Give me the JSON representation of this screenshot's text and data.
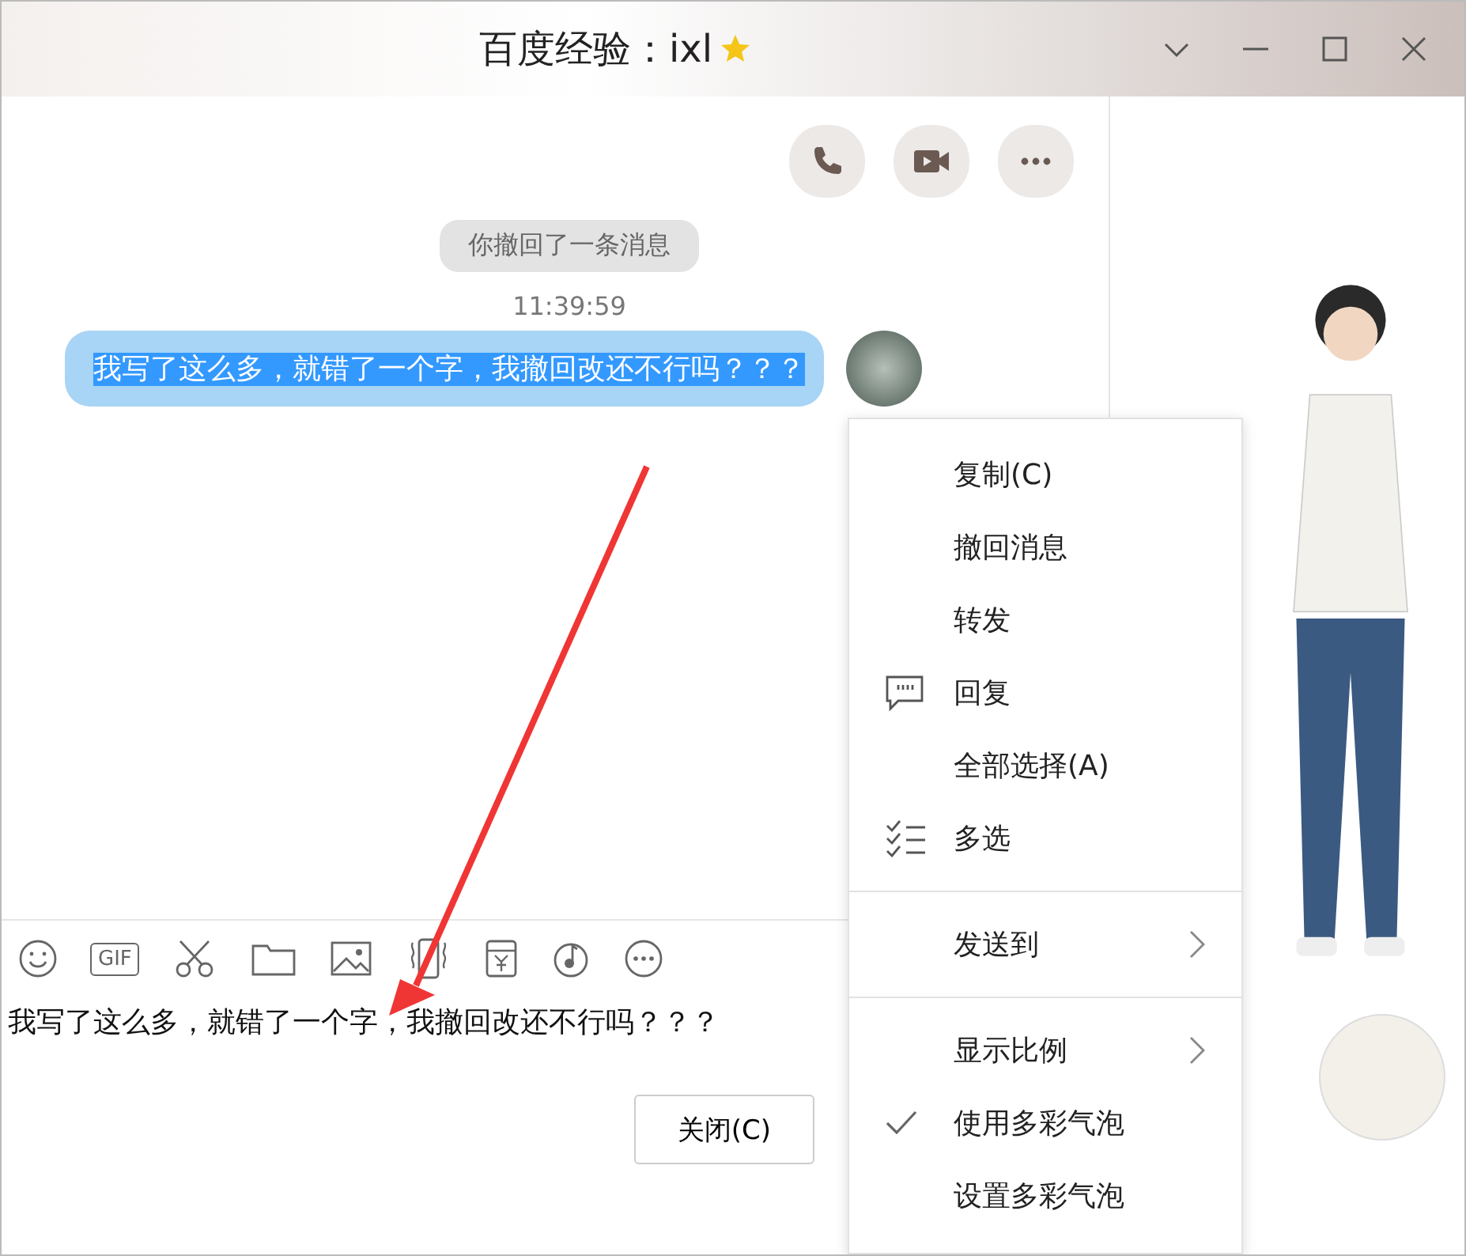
{
  "window": {
    "title": "百度经验：ixl"
  },
  "chat": {
    "recall_notice": "你撤回了一条消息",
    "time": "11:39:59",
    "message": {
      "text": "我写了这么多，就错了一个字，我撤回改还不行吗？？？",
      "selected": true
    }
  },
  "toolbar": {
    "gif_label": "GIF"
  },
  "input": {
    "value": "我写了这么多，就错了一个字，我撤回改还不行吗？？？"
  },
  "close_button": "关闭(C)",
  "context_menu": [
    {
      "label": "复制(C)",
      "kind": "plain",
      "checked": false
    },
    {
      "label": "撤回消息",
      "kind": "plain",
      "checked": false
    },
    {
      "label": "转发",
      "kind": "plain",
      "checked": false
    },
    {
      "label": "回复",
      "kind": "quote",
      "checked": false
    },
    {
      "label": "全部选择(A)",
      "kind": "plain",
      "checked": false
    },
    {
      "label": "多选",
      "kind": "multi",
      "checked": false
    },
    {
      "kind": "separator"
    },
    {
      "label": "发送到",
      "kind": "submenu",
      "checked": false
    },
    {
      "kind": "separator"
    },
    {
      "label": "显示比例",
      "kind": "submenu",
      "checked": false
    },
    {
      "label": "使用多彩气泡",
      "kind": "plain",
      "checked": true
    },
    {
      "label": "设置多彩气泡",
      "kind": "plain",
      "checked": false
    }
  ]
}
